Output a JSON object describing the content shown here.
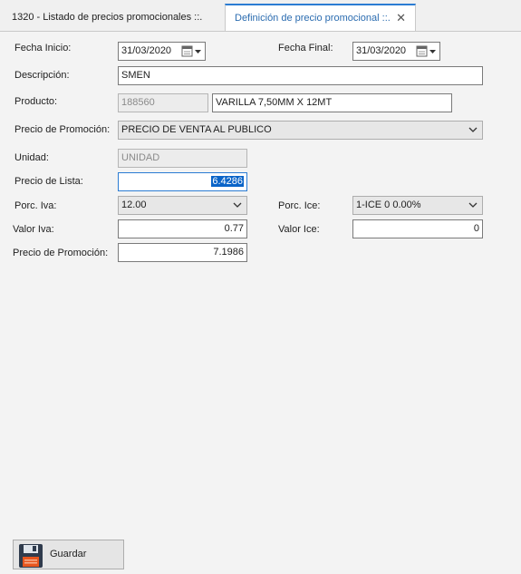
{
  "tabs": [
    {
      "label": "1320 - Listado de precios promocionales ::."
    },
    {
      "label": "Definición de precio promocional ::.",
      "close": "✕"
    }
  ],
  "form": {
    "fecha_inicio": {
      "label": "Fecha Inicio:",
      "value": "31/03/2020"
    },
    "fecha_final": {
      "label": "Fecha Final:",
      "value": "31/03/2020"
    },
    "descripcion": {
      "label": "Descripción:",
      "value": "SMEN"
    },
    "producto": {
      "label": "Producto:",
      "code": "188560",
      "name": "VARILLA 7,50MM X 12MT"
    },
    "precio_promocion_tipo": {
      "label": "Precio de Promoción:",
      "value": "PRECIO DE VENTA AL PUBLICO"
    },
    "unidad": {
      "label": "Unidad:",
      "value": "UNIDAD"
    },
    "precio_lista": {
      "label": "Precio de Lista:",
      "value": "6.4286"
    },
    "porc_iva": {
      "label": "Porc. Iva:",
      "value": "12.00"
    },
    "porc_ice": {
      "label": "Porc. Ice:",
      "value": "1-ICE 0 0.00%"
    },
    "valor_iva": {
      "label": "Valor Iva:",
      "value": "0.77"
    },
    "valor_ice": {
      "label": "Valor Ice:",
      "value": "0"
    },
    "precio_promocion": {
      "label": "Precio de Promoción:",
      "value": "7.1986"
    }
  },
  "actions": {
    "save_label": "Guardar",
    "save_icon": "floppy-disk-icon"
  },
  "colors": {
    "accent": "#2b7cd3",
    "selection": "#0a64c8",
    "tab_active_text": "#2b6cb0"
  }
}
